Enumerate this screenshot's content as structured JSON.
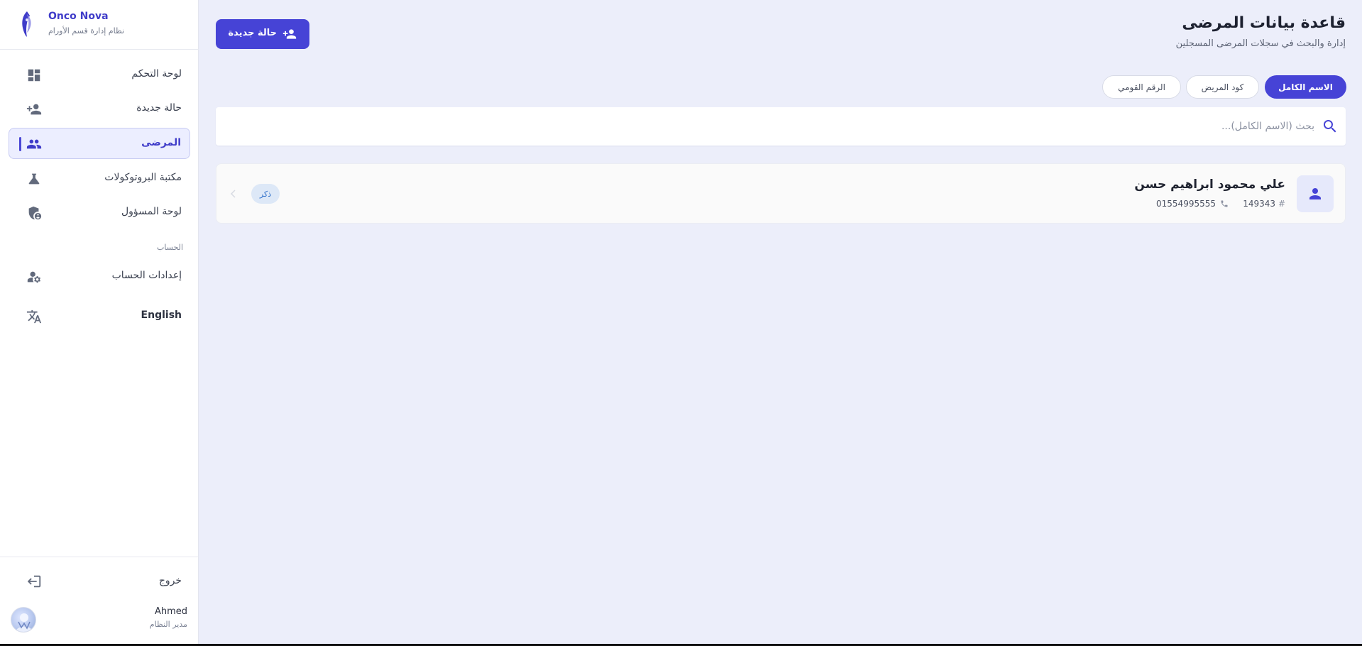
{
  "brand": {
    "name": "Onco Nova",
    "subtitle": "نظام إدارة قسم الأورام"
  },
  "sidebar": {
    "items": [
      {
        "label": "لوحة التحكم",
        "icon": "dashboard-icon"
      },
      {
        "label": "حالة جديدة",
        "icon": "person-add-icon"
      },
      {
        "label": "المرضى",
        "icon": "people-icon",
        "active": true
      },
      {
        "label": "مكتبة البروتوكولات",
        "icon": "flask-icon"
      },
      {
        "label": "لوحة المسؤول",
        "icon": "admin-shield-icon"
      }
    ],
    "section_label": "الحساب",
    "account_items": [
      {
        "label": "إعدادات الحساب",
        "icon": "manage-account-icon"
      },
      {
        "label": "English",
        "icon": "translate-icon"
      }
    ],
    "logout_label": "خروج",
    "user": {
      "name": "Ahmed",
      "role": "مدير النظام"
    }
  },
  "header": {
    "title": "قاعدة بيانات المرضى",
    "subtitle": "إدارة والبحث في سجلات المرضى المسجلين",
    "new_case_label": "حالة جديدة"
  },
  "search": {
    "filters": [
      {
        "label": "الاسم الكامل",
        "selected": true
      },
      {
        "label": "كود المريض",
        "selected": false
      },
      {
        "label": "الرقم القومي",
        "selected": false
      }
    ],
    "placeholder": "بحث (الاسم الكامل)...",
    "value": ""
  },
  "patients": [
    {
      "name": "علي محمود ابراهيم حسن",
      "code": "149343",
      "phone": "01554995555",
      "gender": "ذكر"
    }
  ],
  "colors": {
    "accent": "#4643d6",
    "background": "#eceefa",
    "badge_bg": "#dde8f7",
    "badge_text": "#2e6fc9"
  }
}
